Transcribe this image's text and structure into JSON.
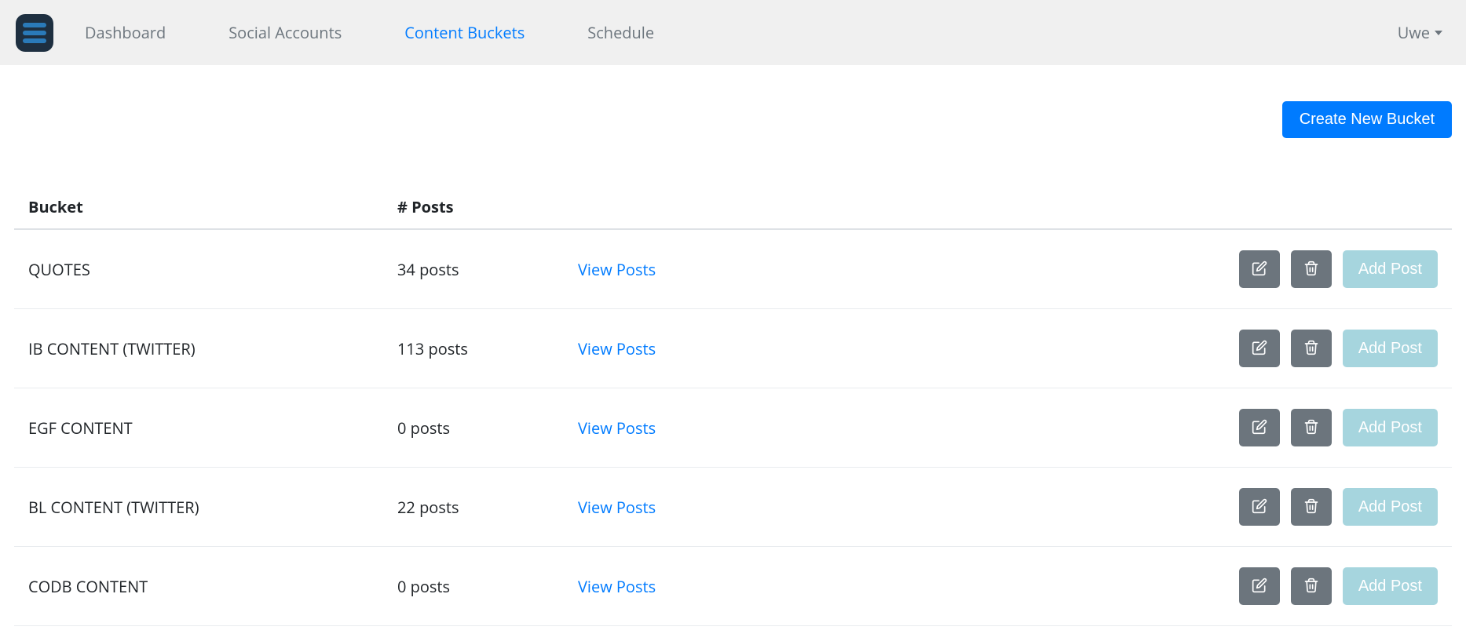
{
  "nav": {
    "items": [
      {
        "label": "Dashboard",
        "active": false
      },
      {
        "label": "Social Accounts",
        "active": false
      },
      {
        "label": "Content Buckets",
        "active": true
      },
      {
        "label": "Schedule",
        "active": false
      }
    ],
    "user": "Uwe"
  },
  "actions": {
    "create_bucket": "Create New Bucket"
  },
  "table": {
    "headers": {
      "bucket": "Bucket",
      "posts": "# Posts"
    },
    "view_posts_label": "View Posts",
    "add_post_label": "Add Post",
    "rows": [
      {
        "name": "QUOTES",
        "posts_text": "34 posts"
      },
      {
        "name": "IB CONTENT (TWITTER)",
        "posts_text": "113 posts"
      },
      {
        "name": "EGF CONTENT",
        "posts_text": "0 posts"
      },
      {
        "name": "BL CONTENT (TWITTER)",
        "posts_text": "22 posts"
      },
      {
        "name": "CODB CONTENT",
        "posts_text": "0 posts"
      }
    ]
  }
}
